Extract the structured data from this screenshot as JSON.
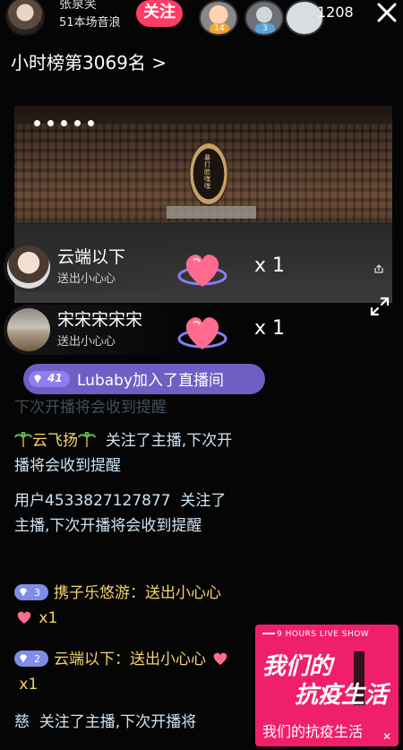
{
  "host": {
    "name": "张泉笑",
    "subtitle": "51本场音浪",
    "follow_label": "关注"
  },
  "viewers": [
    {
      "badge": "14"
    },
    {
      "badge": "3"
    },
    {
      "badge": ""
    }
  ],
  "viewer_count": "1208",
  "rank_text": "小时榜第3069名 >",
  "video": {
    "plaque_text": "暴打脸嘿嘿"
  },
  "gift_notices": [
    {
      "name": "云端以下",
      "action": "送出小心心",
      "count": "x 1"
    },
    {
      "name": "宋宋宋宋宋",
      "action": "送出小心心",
      "count": "x 1"
    }
  ],
  "join": {
    "level": "41",
    "text": "Lubaby加入了直播间"
  },
  "partial_line": "下次开播将会收到提醒",
  "chat": {
    "m1": {
      "user": "云飞扬",
      "text": "关注了主播,下次开播将会收到提醒"
    },
    "m2": {
      "user": "用户4533827127877",
      "text": "关注了主播,下次开播将会收到提醒"
    },
    "m3": {
      "level": "3",
      "user": "携子乐悠游：",
      "text": "送出小心心",
      "count": "x1"
    },
    "m4": {
      "level": "2",
      "user": "云端以下：",
      "text": "送出小心心",
      "count": "x1"
    },
    "m5": {
      "user": "慈",
      "text": "关注了主播,下次开播将"
    }
  },
  "ad": {
    "top_text": "9 HOURS LIVE SHOW",
    "title1": "我们的",
    "title2": "抗疫生活",
    "subtitle": "我们的抗疫生活",
    "close": "✕"
  },
  "colors": {
    "follow": "#ff3c64",
    "join_pill": "#6f5fc4",
    "chat_text": "#cfe3f2",
    "gift_highlight": "#f4d36a",
    "ad": "#f01f6a"
  }
}
